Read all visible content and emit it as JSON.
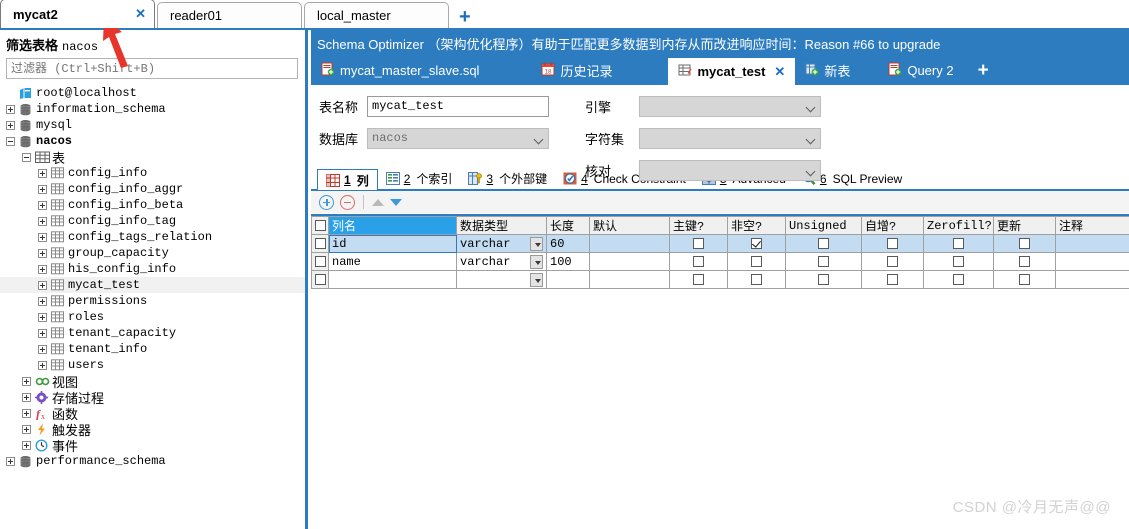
{
  "connection_tabs": [
    {
      "label": "mycat2",
      "active": true,
      "closable": true,
      "close_label": "✕"
    },
    {
      "label": "reader01",
      "active": false,
      "closable": false,
      "close_label": ""
    },
    {
      "label": "local_master",
      "active": false,
      "closable": false,
      "close_label": ""
    }
  ],
  "connection_tabbar": {
    "add_label": "+"
  },
  "sidebar": {
    "filter_title_cn": "筛选表格",
    "filter_title_db": "nacos",
    "filter_placeholder": "过滤器 (Ctrl+Shift+B)",
    "filter_value": "",
    "tree": [
      {
        "label": "root@localhost",
        "icon": "server-icon",
        "indent": 1,
        "expander": "none",
        "mono": true,
        "bold": false,
        "highlight": false
      },
      {
        "label": "information_schema",
        "icon": "database-icon",
        "indent": 1,
        "expander": "plus",
        "mono": true,
        "bold": false,
        "highlight": false
      },
      {
        "label": "mysql",
        "icon": "database-icon",
        "indent": 1,
        "expander": "plus",
        "mono": true,
        "bold": false,
        "highlight": false
      },
      {
        "label": "nacos",
        "icon": "database-icon",
        "indent": 1,
        "expander": "minus",
        "mono": true,
        "bold": true,
        "highlight": false
      },
      {
        "label": "表",
        "icon": "table-group-icon",
        "indent": 2,
        "expander": "minus",
        "mono": false,
        "bold": false,
        "highlight": false
      },
      {
        "label": "config_info",
        "icon": "table-icon",
        "indent": 3,
        "expander": "plus",
        "mono": true,
        "bold": false,
        "highlight": false
      },
      {
        "label": "config_info_aggr",
        "icon": "table-icon",
        "indent": 3,
        "expander": "plus",
        "mono": true,
        "bold": false,
        "highlight": false
      },
      {
        "label": "config_info_beta",
        "icon": "table-icon",
        "indent": 3,
        "expander": "plus",
        "mono": true,
        "bold": false,
        "highlight": false
      },
      {
        "label": "config_info_tag",
        "icon": "table-icon",
        "indent": 3,
        "expander": "plus",
        "mono": true,
        "bold": false,
        "highlight": false
      },
      {
        "label": "config_tags_relation",
        "icon": "table-icon",
        "indent": 3,
        "expander": "plus",
        "mono": true,
        "bold": false,
        "highlight": false
      },
      {
        "label": "group_capacity",
        "icon": "table-icon",
        "indent": 3,
        "expander": "plus",
        "mono": true,
        "bold": false,
        "highlight": false
      },
      {
        "label": "his_config_info",
        "icon": "table-icon",
        "indent": 3,
        "expander": "plus",
        "mono": true,
        "bold": false,
        "highlight": false
      },
      {
        "label": "mycat_test",
        "icon": "table-icon",
        "indent": 3,
        "expander": "plus",
        "mono": true,
        "bold": false,
        "highlight": true
      },
      {
        "label": "permissions",
        "icon": "table-icon",
        "indent": 3,
        "expander": "plus",
        "mono": true,
        "bold": false,
        "highlight": false
      },
      {
        "label": "roles",
        "icon": "table-icon",
        "indent": 3,
        "expander": "plus",
        "mono": true,
        "bold": false,
        "highlight": false
      },
      {
        "label": "tenant_capacity",
        "icon": "table-icon",
        "indent": 3,
        "expander": "plus",
        "mono": true,
        "bold": false,
        "highlight": false
      },
      {
        "label": "tenant_info",
        "icon": "table-icon",
        "indent": 3,
        "expander": "plus",
        "mono": true,
        "bold": false,
        "highlight": false
      },
      {
        "label": "users",
        "icon": "table-icon",
        "indent": 3,
        "expander": "plus",
        "mono": true,
        "bold": false,
        "highlight": false
      },
      {
        "label": "视图",
        "icon": "view-icon",
        "indent": 2,
        "expander": "plus",
        "mono": false,
        "bold": false,
        "highlight": false
      },
      {
        "label": "存储过程",
        "icon": "procedure-icon",
        "indent": 2,
        "expander": "plus",
        "mono": false,
        "bold": false,
        "highlight": false
      },
      {
        "label": "函数",
        "icon": "function-icon",
        "indent": 2,
        "expander": "plus",
        "mono": false,
        "bold": false,
        "highlight": false
      },
      {
        "label": "触发器",
        "icon": "trigger-icon",
        "indent": 2,
        "expander": "plus",
        "mono": false,
        "bold": false,
        "highlight": false
      },
      {
        "label": "事件",
        "icon": "event-icon",
        "indent": 2,
        "expander": "plus",
        "mono": false,
        "bold": false,
        "highlight": false
      },
      {
        "label": "performance_schema",
        "icon": "database-icon",
        "indent": 1,
        "expander": "plus",
        "mono": true,
        "bold": false,
        "highlight": false
      }
    ]
  },
  "banner": {
    "text": "Schema Optimizer （架构优化程序）有助于匹配更多数据到内存从而改进响应时间：Reason #66 to upgrade"
  },
  "inner_tabs": [
    {
      "label": "mycat_master_slave.sql",
      "icon": "sql-file-icon",
      "active": false,
      "closable": false,
      "close_label": ""
    },
    {
      "label": "历史记录",
      "icon": "calendar-icon",
      "active": false,
      "closable": false,
      "close_label": ""
    },
    {
      "label": "mycat_test",
      "icon": "table-edit-icon",
      "active": true,
      "closable": true,
      "close_label": "✕"
    },
    {
      "label": "新表",
      "icon": "new-table-icon",
      "active": false,
      "closable": false,
      "close_label": ""
    },
    {
      "label": "Query 2",
      "icon": "query-icon",
      "active": false,
      "closable": false,
      "close_label": ""
    }
  ],
  "inner_tabbar": {
    "add_label": "+"
  },
  "form": {
    "table_name_label": "表名称",
    "table_name_value": "mycat_test",
    "database_label": "数据库",
    "database_value": "nacos",
    "engine_label": "引擎",
    "engine_value": "",
    "charset_label": "字符集",
    "charset_value": "",
    "collation_label": "核对",
    "collation_value": ""
  },
  "sub_tabs": [
    {
      "num": "1",
      "label": "列",
      "icon": "columns-icon",
      "active": true
    },
    {
      "num": "2",
      "label": "个索引",
      "icon": "index-icon",
      "active": false
    },
    {
      "num": "3",
      "label": "个外部键",
      "icon": "foreign-key-icon",
      "active": false
    },
    {
      "num": "4",
      "label": "Check Constraint",
      "icon": "check-constraint-icon",
      "active": false
    },
    {
      "num": "5",
      "label": "Advanced",
      "icon": "advanced-icon",
      "active": false
    },
    {
      "num": "6",
      "label": "SQL Preview",
      "icon": "magnifier-icon",
      "active": false
    }
  ],
  "grid_toolbar": {
    "add_label": "+",
    "remove_label": "−",
    "move_up_label": "▲",
    "move_down_label": "▼"
  },
  "grid": {
    "headers": [
      "列名",
      "数据类型",
      "长度",
      "默认",
      "主键?",
      "非空?",
      "Unsigned",
      "自增?",
      "Zerofill?",
      "更新",
      "注释"
    ],
    "selected_header_index": 0,
    "rows": [
      {
        "selected": true,
        "name": "id",
        "data_type": "varchar",
        "length": "60",
        "default": "",
        "primary_key": false,
        "not_null": true,
        "unsigned": false,
        "auto_increment": false,
        "zerofill": false,
        "update": false,
        "comment": ""
      },
      {
        "selected": false,
        "name": "name",
        "data_type": "varchar",
        "length": "100",
        "default": "",
        "primary_key": false,
        "not_null": false,
        "unsigned": false,
        "auto_increment": false,
        "zerofill": false,
        "update": false,
        "comment": ""
      },
      {
        "selected": false,
        "name": "",
        "data_type": "",
        "length": "",
        "default": "",
        "primary_key": false,
        "not_null": false,
        "unsigned": false,
        "auto_increment": false,
        "zerofill": false,
        "update": false,
        "comment": ""
      }
    ]
  },
  "watermark": {
    "text": "CSDN @冷月无声@@"
  },
  "colors": {
    "accent": "#2d7cc0",
    "selection": "#c3dcf2",
    "header_selected": "#29a0e8",
    "annotation": "#e8352c"
  }
}
